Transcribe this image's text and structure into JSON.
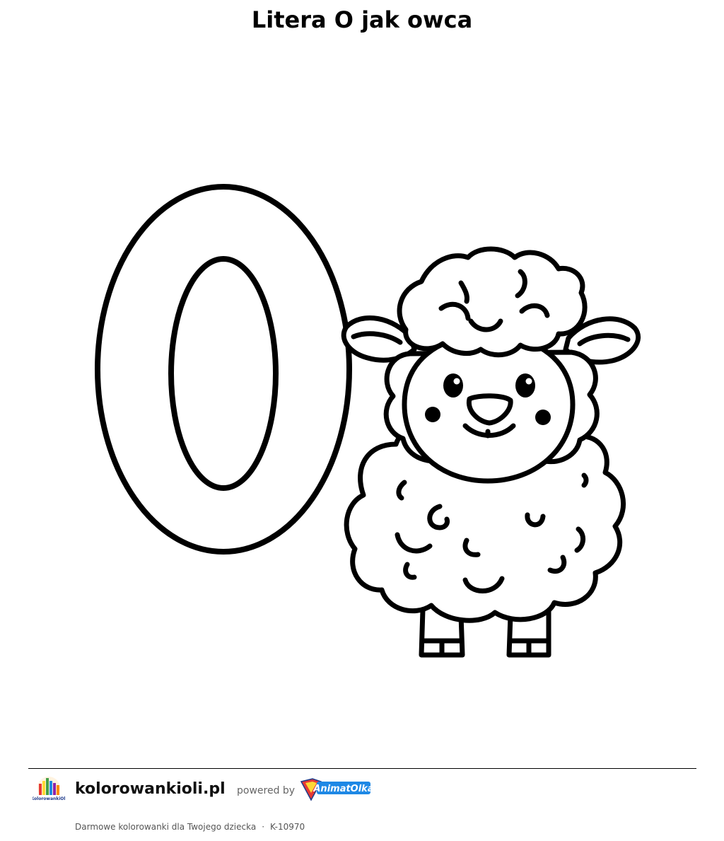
{
  "page": {
    "title": "Litera O jak owca"
  },
  "illustration": {
    "letter": "O",
    "subject": "sheep"
  },
  "footer": {
    "site_name": "kolorowankioli.pl",
    "powered_by": "powered by",
    "logo_small_text": "KolorowankiOli",
    "brand_logo_text": "AnimatOlka",
    "tagline": "Darmowe kolorowanki dla Twojego dziecka",
    "separator": "·",
    "code": "K-10970"
  },
  "colors": {
    "line": "#000000",
    "brand_blue": "#1e88e5",
    "brand_red": "#e53935",
    "brand_yellow": "#fdd835"
  }
}
